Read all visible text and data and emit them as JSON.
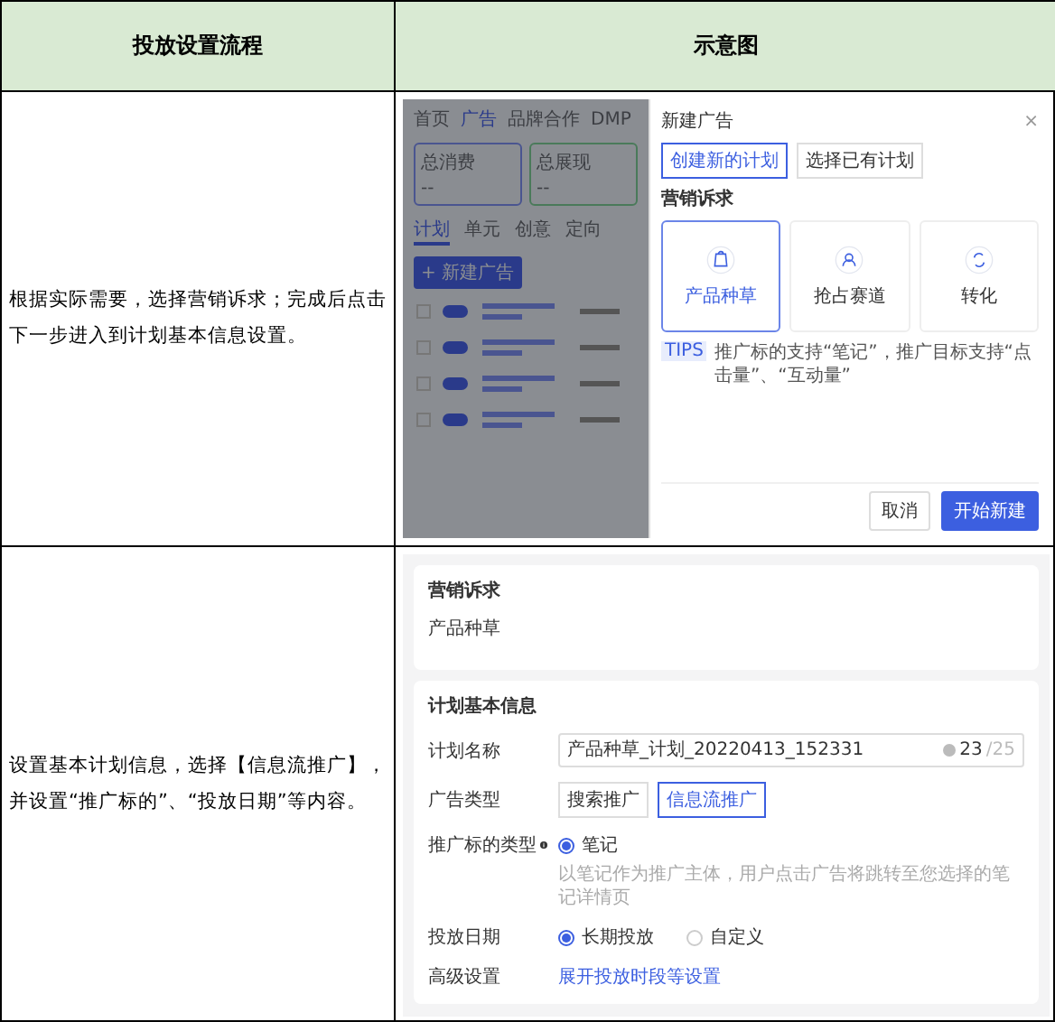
{
  "table": {
    "columns": [
      "投放设置流程",
      "示意图"
    ],
    "rows": [
      {
        "description": "根据实际需要，选择营销诉求；完成后点击下一步进入到计划基本信息设置。",
        "screenshot": {
          "kind": "new_ad_modal",
          "background": {
            "nav": [
              {
                "label": "首页",
                "selected": false
              },
              {
                "label": "广告",
                "selected": true
              },
              {
                "label": "品牌合作",
                "selected": false
              },
              {
                "label": "DMP",
                "selected": false
              }
            ],
            "stats": [
              {
                "label": "总消费",
                "value": "--"
              },
              {
                "label": "总展现",
                "value": "--"
              }
            ],
            "tabs": [
              {
                "label": "计划",
                "selected": true
              },
              {
                "label": "单元",
                "selected": false
              },
              {
                "label": "创意",
                "selected": false
              },
              {
                "label": "定向",
                "selected": false
              }
            ],
            "new_button": "+ 新建广告"
          },
          "modal": {
            "title": "新建广告",
            "close": "×",
            "modes": [
              {
                "label": "创建新的计划",
                "selected": true
              },
              {
                "label": "选择已有计划",
                "selected": false
              }
            ],
            "heading": "营销诉求",
            "goals": [
              {
                "label": "产品种草",
                "selected": true
              },
              {
                "label": "抢占赛道",
                "selected": false
              },
              {
                "label": "转化",
                "selected": false
              }
            ],
            "tips_badge": "TIPS",
            "tips": "推广标的支持“笔记”，推广目标支持“点击量”、“互动量”",
            "buttons": [
              {
                "label": "取消",
                "primary": false
              },
              {
                "label": "开始新建",
                "primary": true
              }
            ]
          }
        }
      },
      {
        "description": "设置基本计划信息，选择【信息流推广】，并设置“推广标的”、“投放日期”等内容。",
        "screenshot": {
          "kind": "plan_form",
          "goal_card": {
            "title": "营销诉求",
            "value": "产品种草"
          },
          "plan_card": {
            "title": "计划基本信息",
            "name": {
              "label": "计划名称",
              "value": "产品种草_计划_20220413_152331",
              "count": "23",
              "max": "/25"
            },
            "ad_type": {
              "label": "广告类型",
              "options": [
                {
                  "label": "搜索推广",
                  "selected": false
                },
                {
                  "label": "信息流推广",
                  "selected": true
                }
              ]
            },
            "target_type": {
              "label": "推广标的类型",
              "options": [
                {
                  "label": "笔记",
                  "selected": true
                }
              ],
              "hint": "以笔记作为推广主体，用户点击广告将跳转至您选择的笔记详情页"
            },
            "date": {
              "label": "投放日期",
              "options": [
                {
                  "label": "长期投放",
                  "selected": true
                },
                {
                  "label": "自定义",
                  "selected": false
                }
              ]
            },
            "advanced": {
              "label": "高级设置",
              "link": "展开投放时段等设置"
            }
          }
        }
      }
    ]
  }
}
